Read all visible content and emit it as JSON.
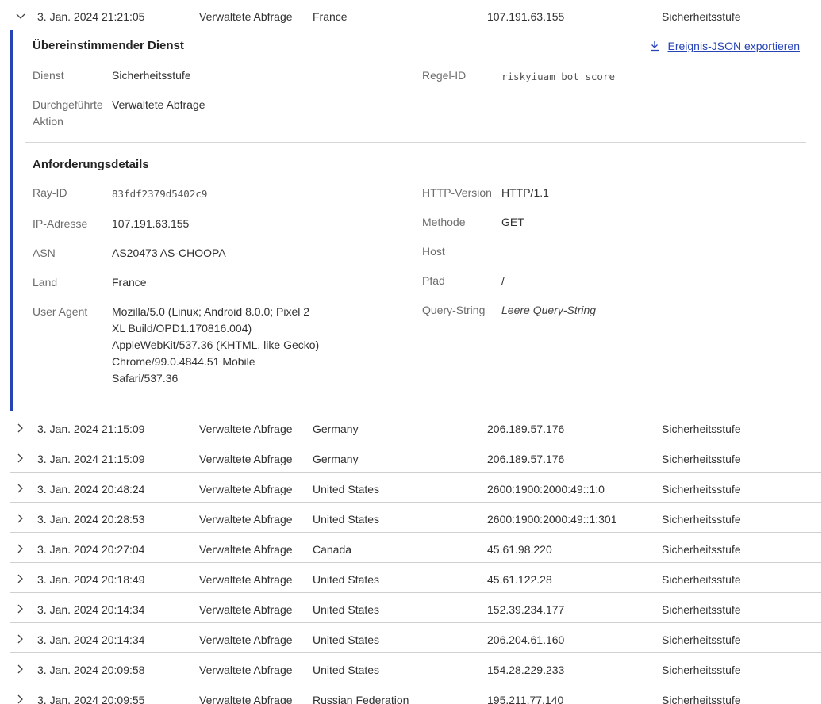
{
  "expanded_event": {
    "date": "3. Jan. 2024 21:21:05",
    "action": "Verwaltete Abfrage",
    "country": "France",
    "ip": "107.191.63.155",
    "service": "Sicherheitsstufe",
    "matched_service": {
      "heading": "Übereinstimmender Dienst",
      "export_label": "Ereignis-JSON exportieren",
      "service_label": "Dienst",
      "service_value": "Sicherheitsstufe",
      "rule_label": "Regel-ID",
      "rule_value": "riskyiuam_bot_score",
      "action_label_1": "Durchgeführte",
      "action_label_2": "Aktion",
      "action_value": "Verwaltete Abfrage"
    },
    "request_details": {
      "heading": "Anforderungsdetails",
      "ray_label": "Ray-ID",
      "ray_value": "83fdf2379d5402c9",
      "ip_label": "IP-Adresse",
      "ip_value": "107.191.63.155",
      "asn_label": "ASN",
      "asn_value": "AS20473 AS-CHOOPA",
      "country_label": "Land",
      "country_value": "France",
      "ua_label": "User Agent",
      "ua_lines": [
        "Mozilla/5.0 (Linux; Android 8.0.0; Pixel 2",
        "XL Build/OPD1.170816.004)",
        "AppleWebKit/537.36 (KHTML, like Gecko)",
        "Chrome/99.0.4844.51 Mobile",
        "Safari/537.36"
      ],
      "http_label": "HTTP-Version",
      "http_value": "HTTP/1.1",
      "method_label": "Methode",
      "method_value": "GET",
      "host_label": "Host",
      "host_value": "",
      "path_label": "Pfad",
      "path_value": "/",
      "query_label": "Query-String",
      "query_value": "Leere Query-String"
    }
  },
  "rows": [
    {
      "date": "3. Jan. 2024 21:15:09",
      "action": "Verwaltete Abfrage",
      "country": "Germany",
      "ip": "206.189.57.176",
      "service": "Sicherheitsstufe"
    },
    {
      "date": "3. Jan. 2024 21:15:09",
      "action": "Verwaltete Abfrage",
      "country": "Germany",
      "ip": "206.189.57.176",
      "service": "Sicherheitsstufe"
    },
    {
      "date": "3. Jan. 2024 20:48:24",
      "action": "Verwaltete Abfrage",
      "country": "United States",
      "ip": "2600:1900:2000:49::1:0",
      "service": "Sicherheitsstufe"
    },
    {
      "date": "3. Jan. 2024 20:28:53",
      "action": "Verwaltete Abfrage",
      "country": "United States",
      "ip": "2600:1900:2000:49::1:301",
      "service": "Sicherheitsstufe"
    },
    {
      "date": "3. Jan. 2024 20:27:04",
      "action": "Verwaltete Abfrage",
      "country": "Canada",
      "ip": "45.61.98.220",
      "service": "Sicherheitsstufe"
    },
    {
      "date": "3. Jan. 2024 20:18:49",
      "action": "Verwaltete Abfrage",
      "country": "United States",
      "ip": "45.61.122.28",
      "service": "Sicherheitsstufe"
    },
    {
      "date": "3. Jan. 2024 20:14:34",
      "action": "Verwaltete Abfrage",
      "country": "United States",
      "ip": "152.39.234.177",
      "service": "Sicherheitsstufe"
    },
    {
      "date": "3. Jan. 2024 20:14:34",
      "action": "Verwaltete Abfrage",
      "country": "United States",
      "ip": "206.204.61.160",
      "service": "Sicherheitsstufe"
    },
    {
      "date": "3. Jan. 2024 20:09:58",
      "action": "Verwaltete Abfrage",
      "country": "United States",
      "ip": "154.28.229.233",
      "service": "Sicherheitsstufe"
    },
    {
      "date": "3. Jan. 2024 20:09:55",
      "action": "Verwaltete Abfrage",
      "country": "Russian Federation",
      "ip": "195.211.77.140",
      "service": "Sicherheitsstufe"
    }
  ],
  "colors": {
    "accent": "#2744b6",
    "border": "#d0d0d0",
    "label": "#6d6d6d"
  },
  "icons": {
    "expanded": "chevron-down-icon",
    "collapsed": "chevron-right-icon",
    "export": "download-icon"
  }
}
